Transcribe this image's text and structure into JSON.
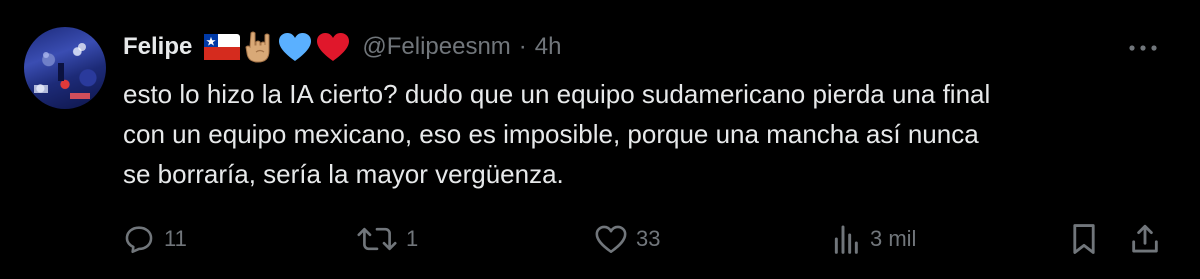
{
  "tweet": {
    "author_name": "Felipe",
    "author_emojis": [
      "chile-flag-icon",
      "rock-hand-icon",
      "blue-heart-icon",
      "red-heart-icon"
    ],
    "handle": "@Felipeesnm",
    "separator": "·",
    "time": "4h",
    "text": "esto lo hizo la IA cierto? dudo que un equipo sudamericano pierda una final\ncon un equipo mexicano, eso es imposible, porque una mancha así nunca\nse borraría, sería la mayor vergüenza."
  },
  "actions": {
    "replies": "11",
    "retweets": "1",
    "likes": "33",
    "views": "3 mil"
  },
  "colors": {
    "background": "#000000",
    "text_primary": "#e7e9ea",
    "text_secondary": "#71767b"
  }
}
